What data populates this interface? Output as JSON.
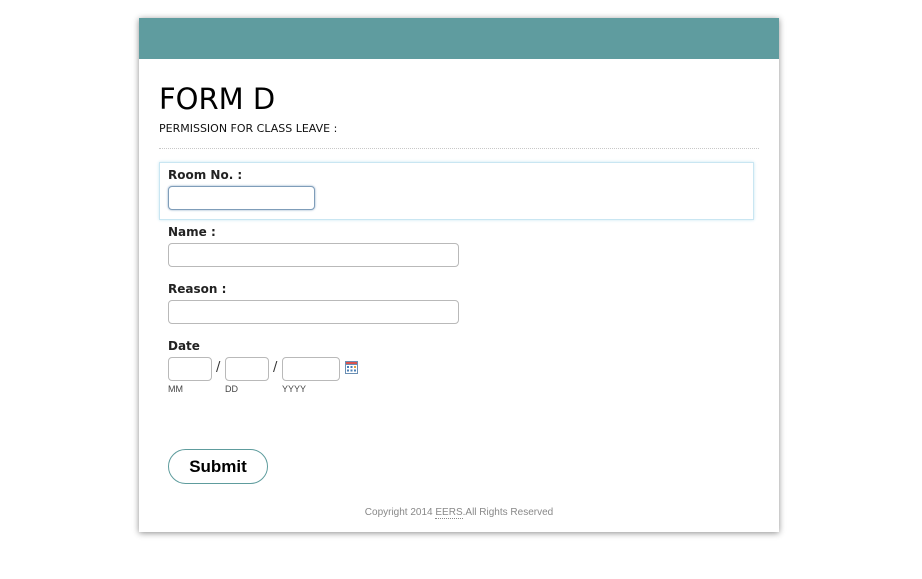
{
  "colors": {
    "header_bar": "#5f9c9f",
    "submit_border": "#5e9c9d"
  },
  "form": {
    "title": "FORM D",
    "subtitle": "PERMISSION FOR CLASS LEAVE :"
  },
  "fields": {
    "room_label": "Room No. :",
    "room_value": "",
    "name_label": "Name :",
    "name_value": "",
    "reason_label": "Reason :",
    "reason_value": "",
    "date_label": "Date",
    "date_mm_value": "",
    "date_dd_value": "",
    "date_yyyy_value": "",
    "date_separator": "/",
    "date_mm_sub": "MM",
    "date_dd_sub": "DD",
    "date_yyyy_sub": "YYYY",
    "calendar_icon": "calendar-icon"
  },
  "actions": {
    "submit_label": "Submit"
  },
  "footer": {
    "prefix": "Copyright 2014 ",
    "link_text": "EERS",
    "suffix": ".All Rights Reserved"
  }
}
